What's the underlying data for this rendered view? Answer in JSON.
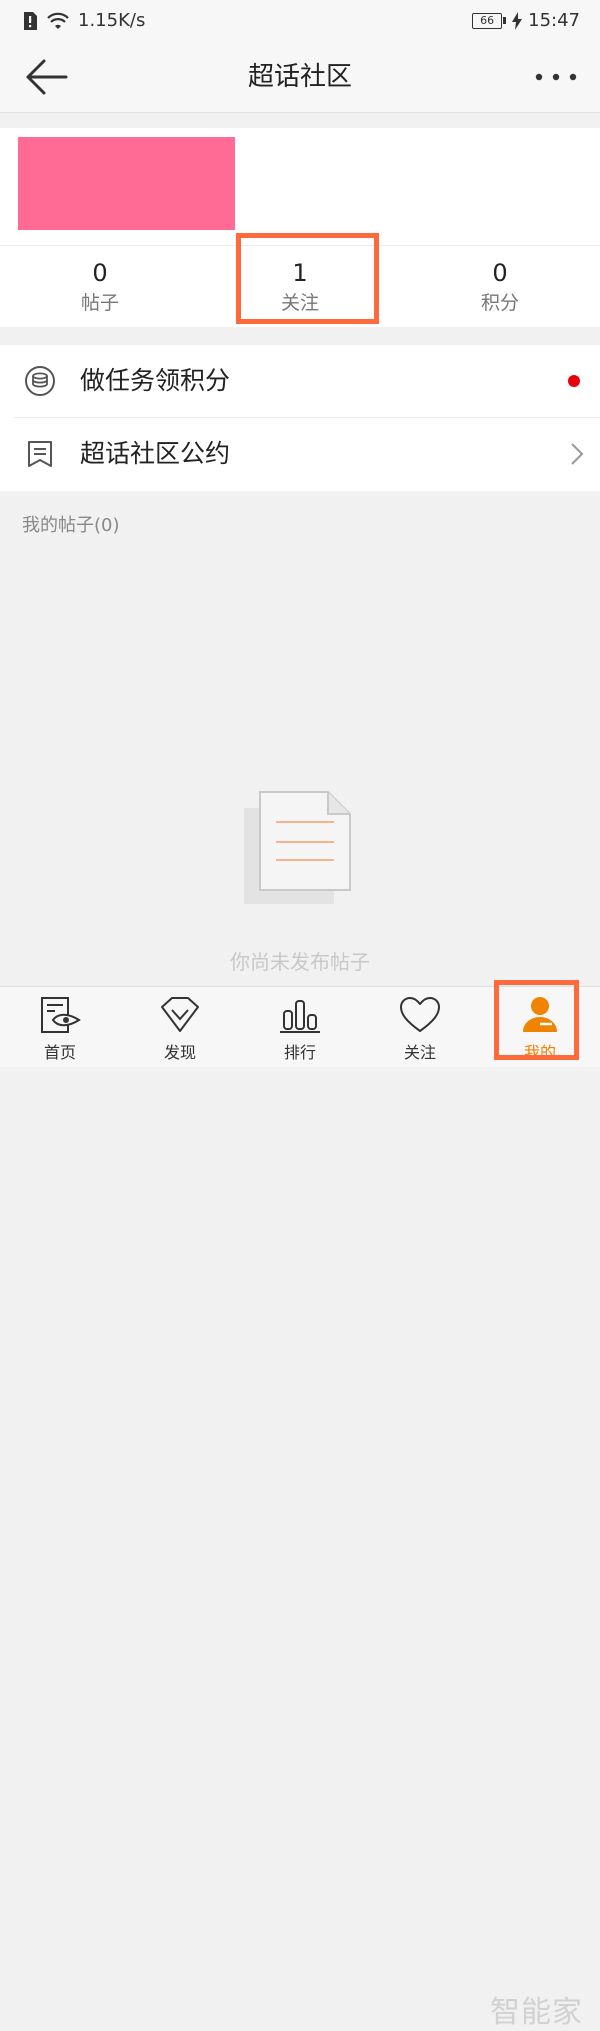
{
  "status_bar": {
    "network_speed": "1.15K/s",
    "battery": "66",
    "time": "15:47"
  },
  "nav": {
    "title": "超话社区",
    "back_icon": "arrow-left-icon",
    "more_icon": "more-dots-icon"
  },
  "profile": {
    "avatar_color": "#ff6b95",
    "stats": [
      {
        "value": "0",
        "label": "帖子"
      },
      {
        "value": "1",
        "label": "关注"
      },
      {
        "value": "0",
        "label": "积分"
      }
    ]
  },
  "menu": [
    {
      "label": "做任务领积分",
      "icon": "coin-stack-icon",
      "badge": "red-dot"
    },
    {
      "label": "超话社区公约",
      "icon": "bookmark-doc-icon",
      "trailing": "chevron-right-icon"
    }
  ],
  "posts": {
    "header": "我的帖子(0)",
    "empty_text": "你尚未发布帖子"
  },
  "tabs": [
    {
      "label": "首页",
      "icon": "home-eye-icon"
    },
    {
      "label": "发现",
      "icon": "diamond-icon"
    },
    {
      "label": "排行",
      "icon": "bar-chart-icon"
    },
    {
      "label": "关注",
      "icon": "heart-icon"
    },
    {
      "label": "我的",
      "icon": "person-icon",
      "active": true
    }
  ],
  "watermark": "智能家",
  "colors": {
    "accent": "#f08300",
    "highlight_box": "#ff6a3d",
    "badge_red": "#e8000b"
  }
}
